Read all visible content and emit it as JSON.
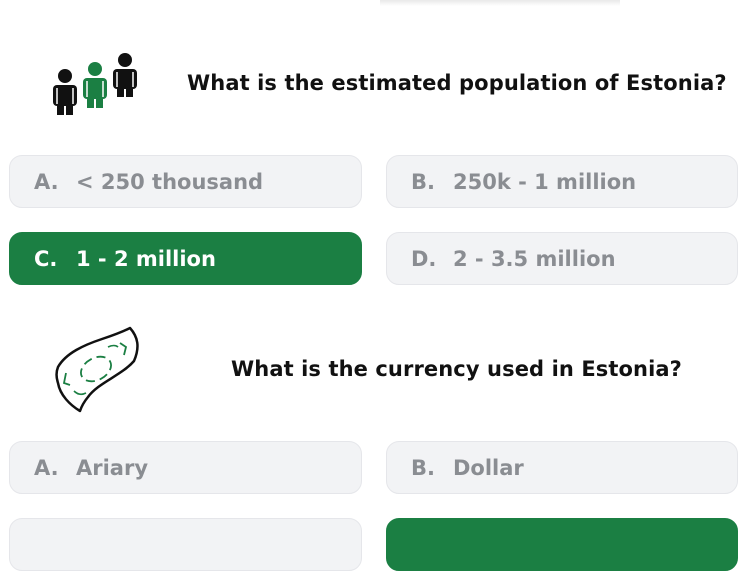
{
  "questions": [
    {
      "icon": "people-icon",
      "text": "What is the estimated population of Estonia?",
      "options": [
        {
          "letter": "A.",
          "label": "< 250 thousand",
          "selected": false
        },
        {
          "letter": "B.",
          "label": "250k - 1 million",
          "selected": false
        },
        {
          "letter": "C.",
          "label": "1 - 2 million",
          "selected": true
        },
        {
          "letter": "D.",
          "label": "2 - 3.5 million",
          "selected": false
        }
      ]
    },
    {
      "icon": "banknote-icon",
      "text": "What is the currency used in Estonia?",
      "options": [
        {
          "letter": "A.",
          "label": "Ariary",
          "selected": false
        },
        {
          "letter": "B.",
          "label": "Dollar",
          "selected": false
        },
        {
          "letter": "",
          "label": "",
          "selected": false
        },
        {
          "letter": "",
          "label": "",
          "selected": true
        }
      ]
    }
  ],
  "colors": {
    "accent": "#1b7f43",
    "option_bg": "#f2f3f5",
    "option_text": "#8a8d92",
    "question_text": "#111111"
  }
}
